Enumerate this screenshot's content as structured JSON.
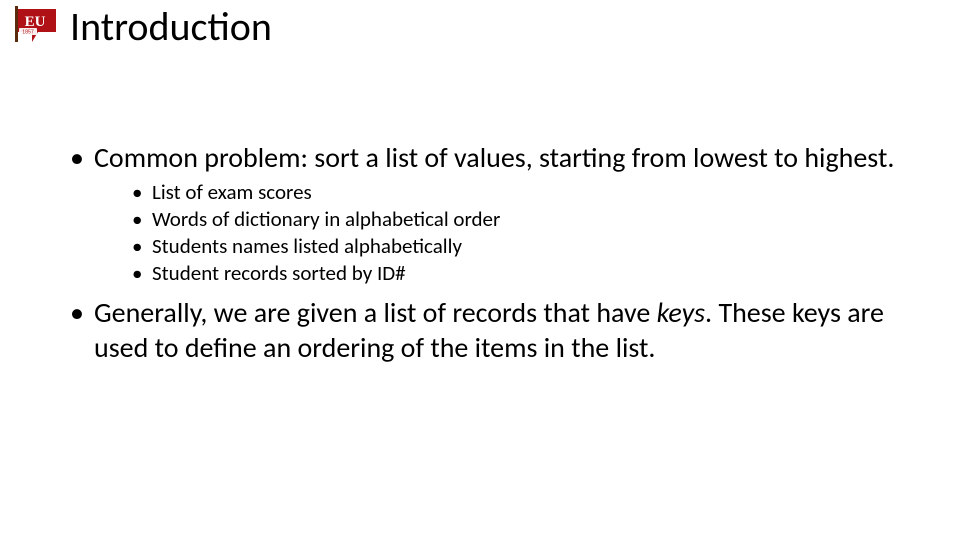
{
  "logo": {
    "letters": "EU",
    "year": "1857"
  },
  "title": "Introduction",
  "bullets": [
    {
      "text": "Common problem: sort a list of values, starting from lowest to highest.",
      "sub": [
        "List of exam scores",
        "Words of dictionary in alphabetical order",
        "Students names listed alphabetically",
        "Student records sorted by ID#"
      ]
    },
    {
      "text_pre": "Generally, we are given a list of records that have ",
      "text_italic": "keys",
      "text_post": ".  These keys are used to define an ordering of the items in the list."
    }
  ]
}
